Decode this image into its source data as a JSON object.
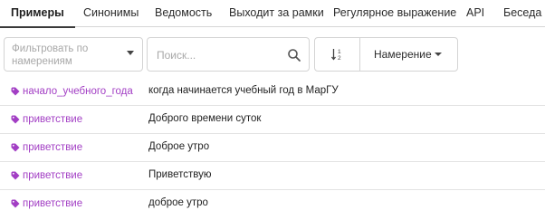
{
  "tabs": [
    {
      "label": "Примеры",
      "active": true
    },
    {
      "label": "Синонимы",
      "active": false
    },
    {
      "label": "Ведомость",
      "active": false
    },
    {
      "label": "Выходит за рамки",
      "active": false
    },
    {
      "label": "Регулярное выражение",
      "active": false
    },
    {
      "label": "API",
      "active": false
    },
    {
      "label": "Беседа",
      "active": false
    }
  ],
  "toolbar": {
    "intent_filter_placeholder": "Фильтровать по намерениям",
    "search_placeholder": "Поиск...",
    "sort_field": "Намерение",
    "search_icon": "search-icon",
    "sort_icon": "sort-ascending-icon"
  },
  "examples": [
    {
      "intent": "начало_учебного_года",
      "text": "когда начинается учебный год в МарГУ"
    },
    {
      "intent": "приветствие",
      "text": "Доброго времени суток"
    },
    {
      "intent": "приветствие",
      "text": "Доброе утро"
    },
    {
      "intent": "приветствие",
      "text": "Приветствую"
    },
    {
      "intent": "приветствие",
      "text": "доброе утро"
    }
  ],
  "colors": {
    "intent_tag": "#a23ec4",
    "active_tab_underline": "#3a3a3a",
    "border": "#d4d4d4"
  }
}
